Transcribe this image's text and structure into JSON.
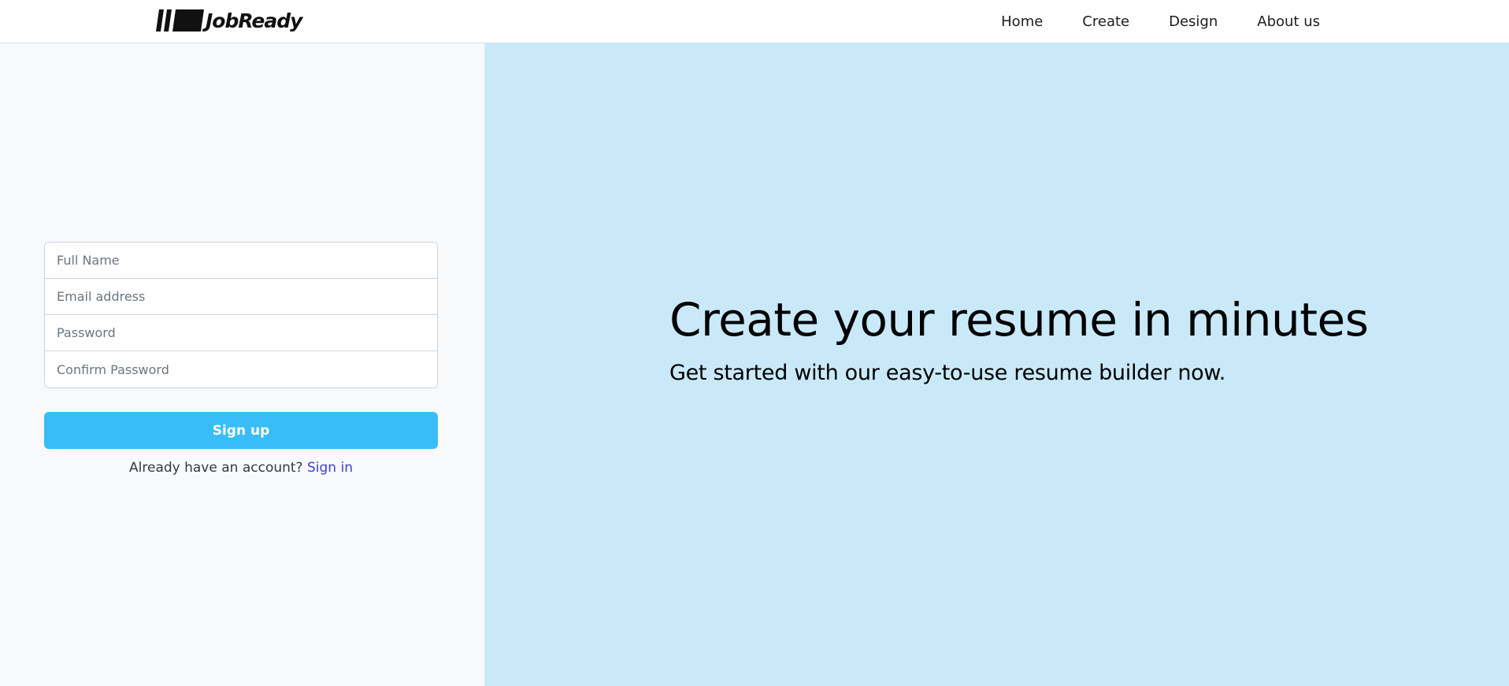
{
  "brand": {
    "name": "JobReady",
    "icon": "logo-bars-icon"
  },
  "nav": {
    "items": [
      {
        "label": "Home"
      },
      {
        "label": "Create"
      },
      {
        "label": "Design"
      },
      {
        "label": "About us"
      }
    ]
  },
  "signup_form": {
    "full_name_placeholder": "Full Name",
    "email_placeholder": "Email address",
    "password_placeholder": "Password",
    "confirm_password_placeholder": "Confirm Password",
    "submit_label": "Sign up",
    "already_text": "Already have an account?",
    "signin_label": "Sign in"
  },
  "hero": {
    "title": "Create your resume in minutes",
    "subtitle": "Get started with our easy-to-use resume builder now."
  },
  "colors": {
    "left_panel_bg": "#f8f9fa",
    "right_panel_bg": "#c9e9f9",
    "button_bg": "#38bdf8",
    "link_color": "#3b3fd6"
  }
}
